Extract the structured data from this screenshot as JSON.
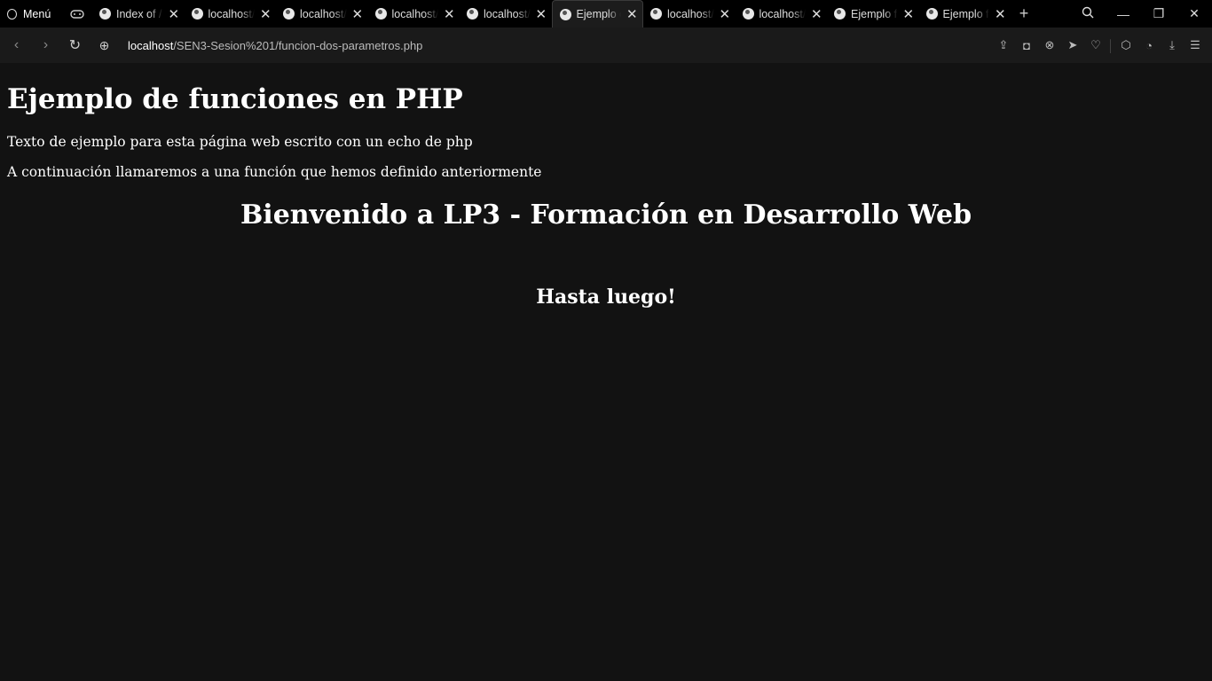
{
  "browser": {
    "menu_label": "Menú",
    "tabs": [
      {
        "label": "Index of /",
        "active": false
      },
      {
        "label": "localhost/",
        "active": false
      },
      {
        "label": "localhost/",
        "active": false
      },
      {
        "label": "localhost/",
        "active": false
      },
      {
        "label": "localhost/",
        "active": false
      },
      {
        "label": "Ejemplo de",
        "active": true
      },
      {
        "label": "localhost/",
        "active": false
      },
      {
        "label": "localhost/",
        "active": false
      },
      {
        "label": "Ejemplo f",
        "active": false
      },
      {
        "label": "Ejemplo f",
        "active": false
      }
    ],
    "url_host": "localhost",
    "url_path": "/SEN3-Sesion%201/funcion-dos-parametros.php"
  },
  "page": {
    "heading": "Ejemplo de funciones en PHP",
    "para1": "Texto de ejemplo para esta página web escrito con un echo de php",
    "para2": "A continuación llamaremos a una función que hemos definido anteriormente",
    "welcome": "Bienvenido a LP3 - Formación en Desarrollo Web",
    "goodbye": "Hasta luego!"
  }
}
